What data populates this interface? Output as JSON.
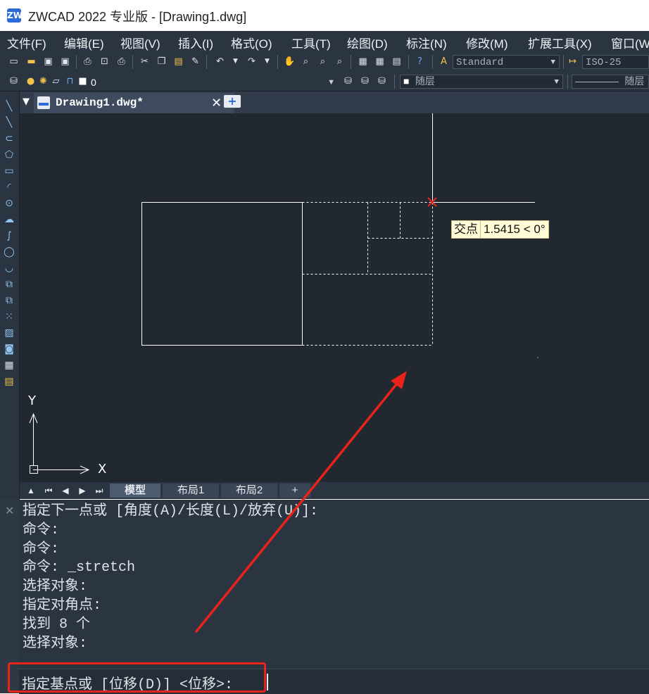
{
  "window": {
    "title": "ZWCAD 2022 专业版 - [Drawing1.dwg]",
    "logo_text": "ZW"
  },
  "menu": {
    "items": [
      {
        "label": "文件(F)"
      },
      {
        "label": "编辑(E)"
      },
      {
        "label": "视图(V)"
      },
      {
        "label": "插入(I)"
      },
      {
        "label": "格式(O)"
      },
      {
        "label": "工具(T)"
      },
      {
        "label": "绘图(D)"
      },
      {
        "label": "标注(N)"
      },
      {
        "label": "修改(M)"
      },
      {
        "label": "扩展工具(X)"
      },
      {
        "label": "窗口(W"
      }
    ]
  },
  "toolbar": {
    "text_style": "Standard",
    "dim_style": "ISO-25",
    "layer": "0",
    "color": "随层",
    "linetype": "随层"
  },
  "doc_tab": {
    "label": "Drawing1.dwg*",
    "close_glyph": "✕",
    "new_glyph": "+"
  },
  "ucs": {
    "x_label": "X",
    "y_label": "Y"
  },
  "tooltip": {
    "snap_label": "交点",
    "value": "1.5415 < 0°"
  },
  "layout_tabs": {
    "model": "模型",
    "layout1": "布局1",
    "layout2": "布局2",
    "add": "+"
  },
  "command": {
    "history": [
      "指定下一点或 [角度(A)/长度(L)/放弃(U)]:",
      "命令:",
      "命令:",
      "命令: _stretch",
      "选择对象:",
      "指定对角点:",
      "找到 8 个",
      "选择对象:"
    ],
    "prompt": "指定基点或 [位移(D)] <位移>:"
  },
  "annotation": {
    "color": "#e8231c"
  }
}
